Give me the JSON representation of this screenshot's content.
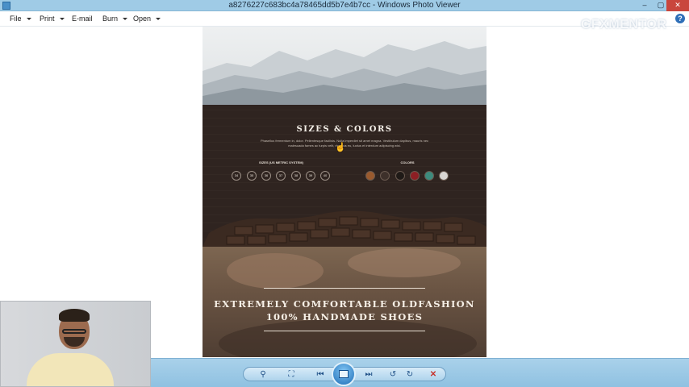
{
  "window": {
    "title": "a8276227c683bc4a78465dd5b7e4b7cc - Windows Photo Viewer",
    "min_glyph": "–",
    "max_glyph": "▢",
    "close_glyph": "✕"
  },
  "menu": {
    "items": [
      {
        "label": "File",
        "has_dropdown": true
      },
      {
        "label": "Print",
        "has_dropdown": true
      },
      {
        "label": "E-mail",
        "has_dropdown": false
      },
      {
        "label": "Burn",
        "has_dropdown": true
      },
      {
        "label": "Open",
        "has_dropdown": true
      }
    ],
    "help_glyph": "?"
  },
  "watermark": "GFXMENTOR",
  "image": {
    "section_heading": "SIZES & COLORS",
    "section_description": "Phasellus fermentum in, dolor. Pellentesque facilisis. Nulla imperdiet sit amet magna. Vestibulum dapibus, mauris nec malesuada fames ac turpis velit, rhoncus eu, luctus et interdum adipiscing wisi.",
    "sizes_label": "SIZES (US METRIC SYSTEM)",
    "sizes": [
      "34",
      "35",
      "36",
      "37",
      "38",
      "39",
      "40"
    ],
    "colors_label": "COLORS",
    "colors": [
      "#9a5a2e",
      "#3d302a",
      "#1f1a17",
      "#8e1f24",
      "#3d8b7d",
      "#d9d6d2"
    ],
    "headline_line1": "EXTREMELY COMFORTABLE OLDFASHION",
    "headline_line2": "100% HANDMADE SHOES"
  },
  "toolbar": {
    "zoom_glyph": "⚲",
    "fit_glyph": "⛶",
    "prev_glyph": "⏮",
    "next_glyph": "⏭",
    "rotate_ccw_glyph": "↺",
    "rotate_cw_glyph": "↻",
    "delete_glyph": "✕"
  }
}
